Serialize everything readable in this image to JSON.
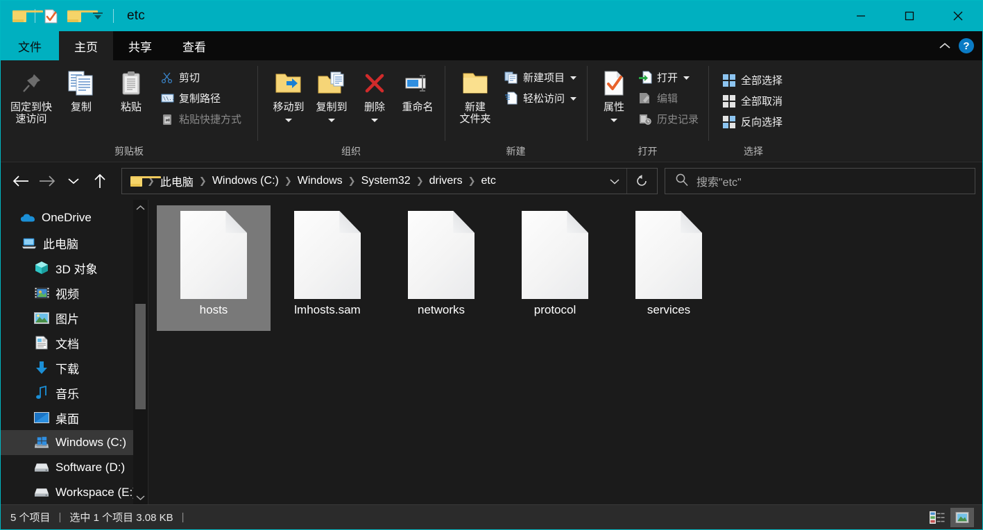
{
  "window": {
    "title": "etc",
    "accent_color": "#00b0c0",
    "quick_access": [
      {
        "name": "folder-icon",
        "label": "资源管理器"
      },
      {
        "name": "properties-icon",
        "label": "属性"
      },
      {
        "name": "new-folder-icon",
        "label": "新建文件夹"
      },
      {
        "name": "customize-qat-icon",
        "label": "自定义快速访问工具栏"
      }
    ],
    "caption": {
      "minimize": "最小化",
      "maximize": "最大化",
      "close": "关闭"
    }
  },
  "tabs": [
    {
      "label": "文件",
      "kind": "file"
    },
    {
      "label": "主页",
      "kind": "active"
    },
    {
      "label": "共享",
      "kind": "normal"
    },
    {
      "label": "查看",
      "kind": "normal"
    }
  ],
  "ribbon_right": {
    "collapse": "折叠功能区",
    "help": "?"
  },
  "ribbon": {
    "groups": [
      {
        "label": "剪贴板",
        "big": [
          {
            "label": "固定到快\n速访问",
            "icon": "pin-icon"
          },
          {
            "label": "复制",
            "icon": "copy-icon"
          },
          {
            "label": "粘贴",
            "icon": "paste-icon"
          }
        ],
        "small": [
          {
            "label": "剪切",
            "icon": "scissors-icon",
            "dim": false
          },
          {
            "label": "复制路径",
            "icon": "copy-path-icon",
            "dim": false
          },
          {
            "label": "粘贴快捷方式",
            "icon": "paste-shortcut-icon",
            "dim": true
          }
        ]
      },
      {
        "label": "组织",
        "big": [
          {
            "label": "移动到",
            "icon": "move-to-icon",
            "caret": true
          },
          {
            "label": "复制到",
            "icon": "copy-to-icon",
            "caret": true
          },
          {
            "label": "删除",
            "icon": "delete-icon",
            "caret": true
          },
          {
            "label": "重命名",
            "icon": "rename-icon"
          }
        ],
        "small": []
      },
      {
        "label": "新建",
        "big": [
          {
            "label": "新建\n文件夹",
            "icon": "new-folder-icon"
          }
        ],
        "small": [
          {
            "label": "新建项目",
            "icon": "new-item-icon",
            "caret": true,
            "dim": false
          },
          {
            "label": "轻松访问",
            "icon": "easy-access-icon",
            "caret": true,
            "dim": false
          }
        ]
      },
      {
        "label": "打开",
        "big": [
          {
            "label": "属性",
            "icon": "properties-icon",
            "caret": true
          }
        ],
        "small": [
          {
            "label": "打开",
            "icon": "open-icon",
            "caret": true,
            "dim": false
          },
          {
            "label": "编辑",
            "icon": "edit-icon",
            "dim": true
          },
          {
            "label": "历史记录",
            "icon": "history-icon",
            "dim": true
          }
        ]
      },
      {
        "label": "选择",
        "big": [],
        "small": [
          {
            "label": "全部选择",
            "icon": "select-all-icon",
            "dim": false
          },
          {
            "label": "全部取消",
            "icon": "select-none-icon",
            "dim": false
          },
          {
            "label": "反向选择",
            "icon": "invert-selection-icon",
            "dim": false
          }
        ]
      }
    ]
  },
  "navigation": {
    "back": "后退",
    "forward": "前进",
    "recent": "最近浏览的位置",
    "up": "上移到",
    "breadcrumbs": [
      "此电脑",
      "Windows (C:)",
      "Windows",
      "System32",
      "drivers",
      "etc"
    ],
    "dropdown": "以前的位置",
    "refresh": "刷新"
  },
  "search": {
    "placeholder": "搜索\"etc\"",
    "value": "",
    "icon": "search-icon"
  },
  "sidebar": {
    "items": [
      {
        "label": "OneDrive",
        "icon": "onedrive-icon",
        "indent": 1,
        "selected": false
      },
      {
        "label": "此电脑",
        "icon": "this-pc-icon",
        "indent": 1,
        "selected": false
      },
      {
        "label": "3D 对象",
        "icon": "3d-objects-icon",
        "indent": 2,
        "selected": false
      },
      {
        "label": "视频",
        "icon": "videos-icon",
        "indent": 2,
        "selected": false
      },
      {
        "label": "图片",
        "icon": "pictures-icon",
        "indent": 2,
        "selected": false
      },
      {
        "label": "文档",
        "icon": "documents-icon",
        "indent": 2,
        "selected": false
      },
      {
        "label": "下载",
        "icon": "downloads-icon",
        "indent": 2,
        "selected": false
      },
      {
        "label": "音乐",
        "icon": "music-icon",
        "indent": 2,
        "selected": false
      },
      {
        "label": "桌面",
        "icon": "desktop-icon",
        "indent": 2,
        "selected": false
      },
      {
        "label": "Windows (C:)",
        "icon": "windows-drive-icon",
        "indent": 2,
        "selected": true
      },
      {
        "label": "Software (D:)",
        "icon": "drive-icon",
        "indent": 2,
        "selected": false
      },
      {
        "label": "Workspace (E:)",
        "icon": "drive-icon",
        "indent": 2,
        "selected": false
      }
    ]
  },
  "files": {
    "items": [
      {
        "name": "hosts",
        "icon": "generic-file-icon",
        "selected": true
      },
      {
        "name": "lmhosts.sam",
        "icon": "generic-file-icon",
        "selected": false
      },
      {
        "name": "networks",
        "icon": "generic-file-icon",
        "selected": false
      },
      {
        "name": "protocol",
        "icon": "generic-file-icon",
        "selected": false
      },
      {
        "name": "services",
        "icon": "generic-file-icon",
        "selected": false
      }
    ]
  },
  "status": {
    "item_count": "5 个项目",
    "separator1": "|",
    "selection": "选中 1 个项目  3.08 KB",
    "separator2": "|",
    "views": [
      {
        "name": "details-view-button",
        "label": "详细信息",
        "active": false
      },
      {
        "name": "large-icons-view-button",
        "label": "大图标",
        "active": true
      }
    ]
  }
}
